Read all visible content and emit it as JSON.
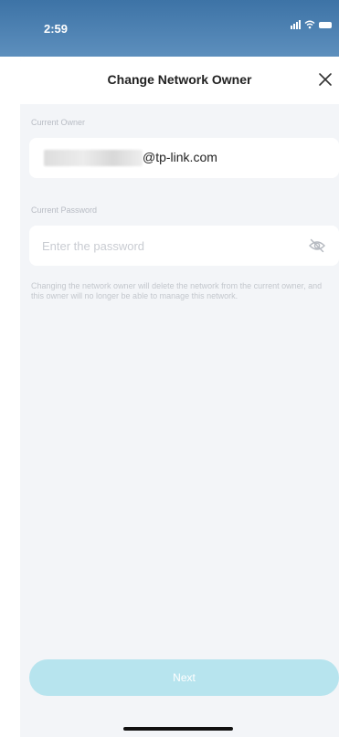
{
  "status_bar": {
    "time": "2:59"
  },
  "header": {
    "title": "Change Network Owner"
  },
  "current_owner": {
    "label": "Current Owner",
    "email_suffix": "@tp-link.com"
  },
  "current_password": {
    "label": "Current Password",
    "placeholder": "Enter the password",
    "value": ""
  },
  "notice": "Changing the network owner will delete the network from the current owner, and this owner will no longer be able to manage this network.",
  "footer": {
    "next_label": "Next"
  },
  "colors": {
    "status_bar": "#4a7fb0",
    "sheet_background": "#f3f5f8",
    "button_disabled": "#b7e4ee"
  },
  "icons": [
    "wifi-icon",
    "cellular-signal-icon",
    "battery-icon",
    "close-icon",
    "eye-off-icon"
  ]
}
